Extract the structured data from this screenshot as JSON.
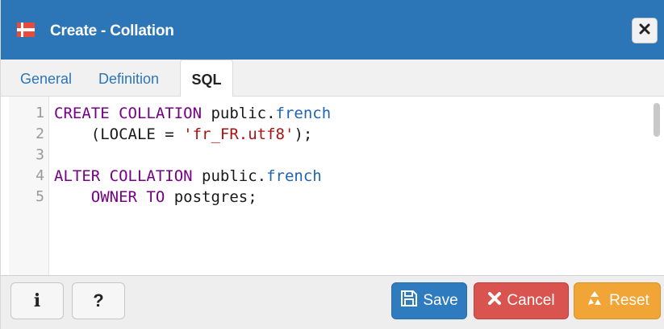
{
  "dialog": {
    "title": "Create - Collation",
    "title_icon": "collation-icon",
    "close_icon": "close-icon"
  },
  "tabs": [
    {
      "label": "General",
      "active": false
    },
    {
      "label": "Definition",
      "active": false
    },
    {
      "label": "SQL",
      "active": true
    }
  ],
  "editor": {
    "lines": [
      {
        "number": "1",
        "text": "CREATE COLLATION public.french"
      },
      {
        "number": "2",
        "text": "    (LOCALE = 'fr_FR.utf8');"
      },
      {
        "number": "3",
        "text": ""
      },
      {
        "number": "4",
        "text": "ALTER COLLATION public.french"
      },
      {
        "number": "5",
        "text": "    OWNER TO postgres;"
      }
    ],
    "segments": {
      "l1_kw": "CREATE COLLATION",
      "l1_schema": " public.",
      "l1_name": "french",
      "l2_open": "    (LOCALE = ",
      "l2_str": "'fr_FR.utf8'",
      "l2_close": ");",
      "l4_kw": "ALTER COLLATION",
      "l4_schema": " public.",
      "l4_name": "french",
      "l5_indent": "    ",
      "l5_kw": "OWNER TO",
      "l5_owner": " postgres;"
    }
  },
  "footer": {
    "info_label": "i",
    "help_label": "?",
    "save_label": "Save",
    "cancel_label": "Cancel",
    "reset_label": "Reset"
  },
  "colors": {
    "titlebar": "#2c76b8",
    "save": "#2e7bbf",
    "cancel": "#d9534f",
    "reset": "#f0a536",
    "keyword": "#770088",
    "identifier": "#1e64b4",
    "string": "#aa1111"
  }
}
